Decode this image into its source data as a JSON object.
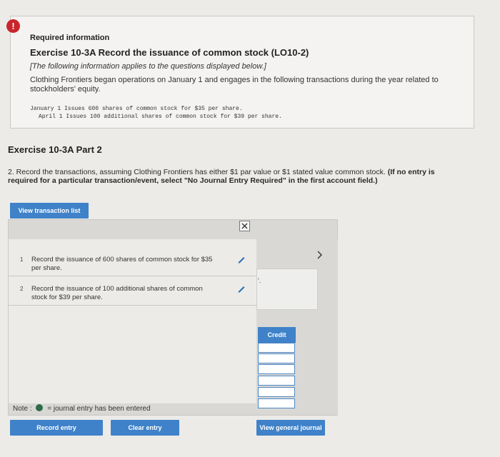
{
  "header": {
    "alert_glyph": "!",
    "required": "Required information",
    "exercise_title": "Exercise 10-3A Record the issuance of common stock (LO10-2)",
    "note": "[The following information applies to the questions displayed below.]",
    "body": "Clothing Frontiers began operations on January 1 and engages in the following transactions during the year related to stockholders' equity.",
    "transactions": [
      "January 1 Issues 600 shares of common stock for $35 per share.",
      "April 1 Issues 100 additional shares of common stock for $39 per share."
    ]
  },
  "part": {
    "title": "Exercise 10-3A Part 2",
    "instruction_plain": "2. Record the transactions, assuming Clothing Frontiers has either $1 par value or $1 stated value common stock.",
    "instruction_bold": "(If no entry is required for a particular transaction/event, select \"No Journal Entry Required\" in the first account field.)"
  },
  "buttons": {
    "view_transaction_list": "View transaction list",
    "record_entry": "Record entry",
    "clear_entry": "Clear entry",
    "view_general_journal": "View general journal"
  },
  "transaction_list": [
    {
      "num": "1",
      "text": "Record the issuance of 600 shares of common stock for $35 per share."
    },
    {
      "num": "2",
      "text": "Record the issuance of 100 additional shares of common stock for $39 per share."
    }
  ],
  "journal": {
    "close_glyph": "×",
    "truncated_text": "'.",
    "next_glyph": "›",
    "credit_header": "Credit"
  },
  "legend": {
    "prefix": "Note :",
    "text": "= journal entry has been entered"
  },
  "colors": {
    "accent": "#3f82c9",
    "alert": "#c9252c",
    "entered_dot": "#2e6b4a"
  }
}
